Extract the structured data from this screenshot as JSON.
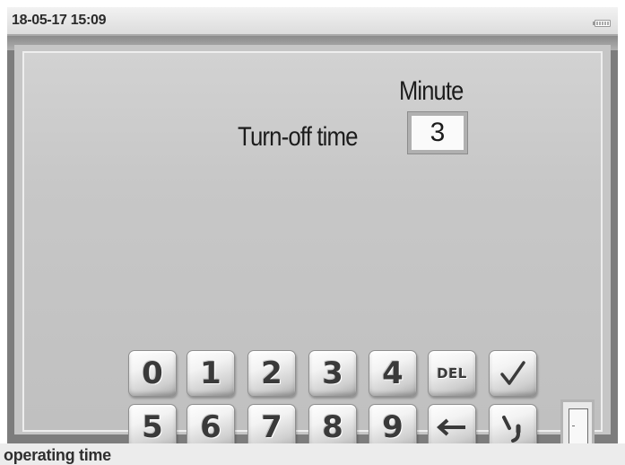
{
  "status_bar": {
    "datetime": "18-05-17 15:09",
    "battery_icon": "battery-icon"
  },
  "settings": {
    "field_label": "Turn-off time",
    "unit_label": "Minute",
    "value": "3"
  },
  "keypad": {
    "row1": [
      {
        "label": "0",
        "name": "key-0"
      },
      {
        "label": "1",
        "name": "key-1"
      },
      {
        "label": "2",
        "name": "key-2"
      },
      {
        "label": "3",
        "name": "key-3"
      },
      {
        "label": "4",
        "name": "key-4"
      },
      {
        "label": "DEL",
        "name": "key-del"
      },
      {
        "label": "",
        "name": "key-confirm",
        "icon": "checkmark-icon"
      }
    ],
    "row2": [
      {
        "label": "5",
        "name": "key-5"
      },
      {
        "label": "6",
        "name": "key-6"
      },
      {
        "label": "7",
        "name": "key-7"
      },
      {
        "label": "8",
        "name": "key-8"
      },
      {
        "label": "9",
        "name": "key-9"
      },
      {
        "label": "",
        "name": "key-backspace",
        "icon": "left-arrow-icon"
      },
      {
        "label": "",
        "name": "key-separator",
        "icon": "separator-icon"
      }
    ]
  },
  "page_button": {
    "icon": "door-icon"
  },
  "footer": {
    "text": "operating time"
  }
}
